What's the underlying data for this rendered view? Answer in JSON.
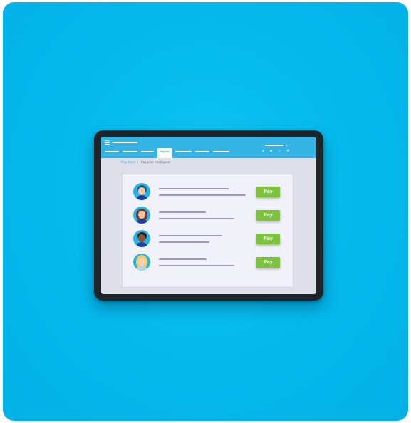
{
  "app": {
    "active_tab": "Payroll",
    "account_caret": "▾"
  },
  "breadcrumb": {
    "link": "Pay Runs",
    "separator": "|",
    "current": "Pay your employees"
  },
  "employees": [
    {
      "pay_label": "Pay",
      "avatar_hair": "#1f5d78",
      "avatar_skin": "#f1c7a8",
      "shirt": "#1e3f9a"
    },
    {
      "pay_label": "Pay",
      "avatar_hair": "#7a3b22",
      "avatar_skin": "#f2c1a4",
      "shirt": "#1e3f9a"
    },
    {
      "pay_label": "Pay",
      "avatar_hair": "#2b1a12",
      "avatar_skin": "#8a5633",
      "shirt": "#1e3f9a"
    },
    {
      "pay_label": "Pay",
      "avatar_hair": "#f2cf5a",
      "avatar_skin": "#f6d2b3",
      "shirt": "#b2d6e8"
    }
  ],
  "colors": {
    "background": "#04b8ec",
    "topbar": "#33b4e4",
    "pay_button": "#7dc23c",
    "placeholder_lines": "#9a98c8"
  },
  "icons": [
    "menu-icon",
    "bell-icon",
    "message-icon",
    "search-icon",
    "settings-icon"
  ]
}
